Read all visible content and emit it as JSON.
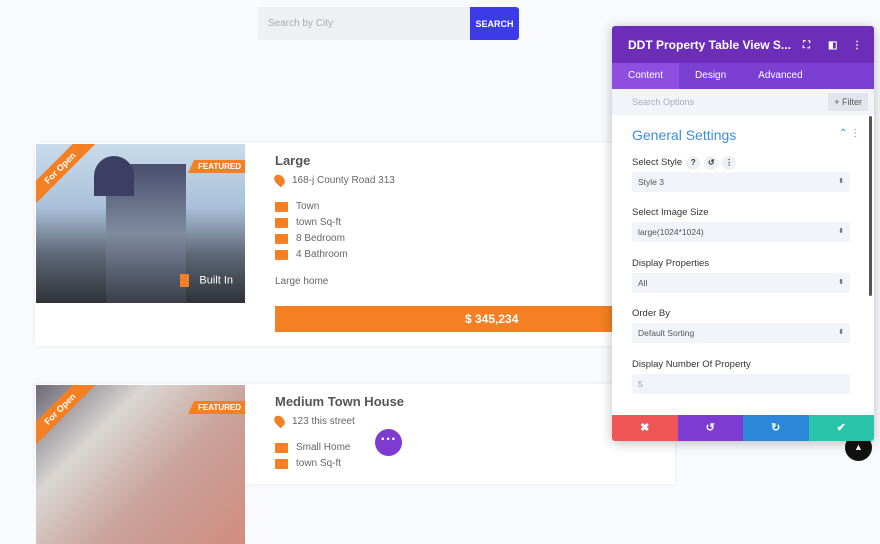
{
  "search": {
    "placeholder": "Search by City",
    "button": "SEARCH"
  },
  "properties": [
    {
      "ribbon": "For Open",
      "badge": "FEATURED",
      "built": "Built In",
      "title": "Large",
      "address": "168-j County Road 313",
      "type": "Town",
      "area": "town Sq-ft",
      "bedrooms": "8 Bedroom",
      "bathrooms": "4 Bathroom",
      "description": "Large home",
      "price": "$ 345,234"
    },
    {
      "ribbon": "For Open",
      "badge": "FEATURED",
      "title": "Medium Town House",
      "address": "123 this street",
      "type": "Small Home",
      "area": "town Sq-ft"
    }
  ],
  "panel": {
    "title": "DDT Property Table View S...",
    "tabs": [
      "Content",
      "Design",
      "Advanced"
    ],
    "search_placeholder": "Search Options",
    "filter": "+ Filter",
    "section": "General Settings",
    "fields": [
      {
        "label": "Select Style",
        "value": "Style 3"
      },
      {
        "label": "Select Image Size",
        "value": "large(1024*1024)"
      },
      {
        "label": "Display Properties",
        "value": "All"
      },
      {
        "label": "Order By",
        "value": "Default Sorting"
      },
      {
        "label": "Display Number Of Property",
        "value": "5"
      }
    ]
  },
  "colors": {
    "accent": "#f58024",
    "panel": "#6c2eb9",
    "cancel": "#ef5555",
    "undo": "#7e3bd0",
    "redo": "#2b87da",
    "save": "#29c4a9"
  }
}
